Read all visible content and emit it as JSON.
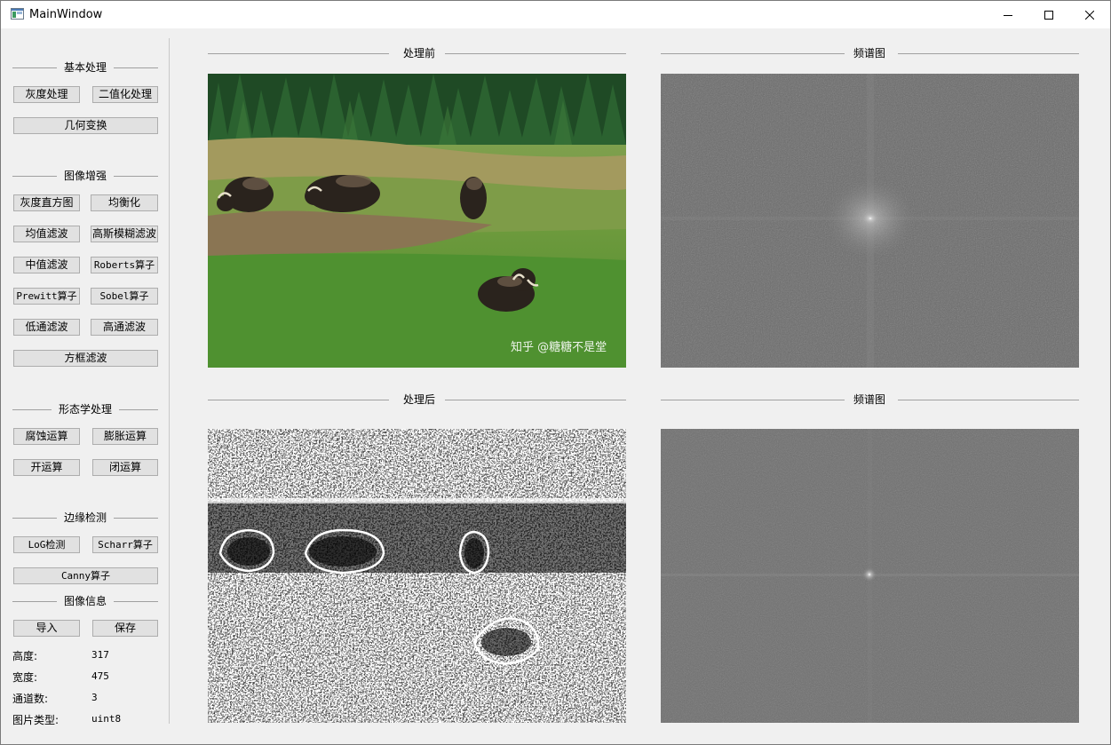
{
  "window": {
    "title": "MainWindow",
    "controls": [
      "minimize",
      "maximize",
      "close"
    ]
  },
  "sidebar": {
    "groups": {
      "basic": {
        "title": "基本处理",
        "buttons": {
          "gray": "灰度处理",
          "binary": "二值化处理",
          "geometry": "几何变换"
        }
      },
      "enhance": {
        "title": "图像增强",
        "buttons": {
          "histogram": "灰度直方图",
          "equalize": "均衡化",
          "mean_filter": "均值滤波",
          "gaussian_blur": "高斯模糊滤波",
          "median_filter": "中值滤波",
          "roberts": "Roberts算子",
          "prewitt": "Prewitt算子",
          "sobel": "Sobel算子",
          "lowpass": "低通滤波",
          "highpass": "高通滤波",
          "box_filter": "方框滤波"
        }
      },
      "morphology": {
        "title": "形态学处理",
        "buttons": {
          "erode": "腐蚀运算",
          "dilate": "膨胀运算",
          "open": "开运算",
          "close": "闭运算"
        }
      },
      "edge": {
        "title": "边缘检测",
        "buttons": {
          "log": "LoG检测",
          "scharr": "Scharr算子",
          "canny": "Canny算子"
        }
      },
      "info": {
        "title": "图像信息",
        "buttons": {
          "import": "导入",
          "save": "保存"
        },
        "fields": [
          {
            "label": "高度:",
            "value": "317"
          },
          {
            "label": "宽度:",
            "value": "475"
          },
          {
            "label": "通道数:",
            "value": "3"
          },
          {
            "label": "图片类型:",
            "value": "uint8"
          }
        ]
      }
    }
  },
  "panels": {
    "before": {
      "title": "处理前",
      "watermark": "知乎 @糖糖不是堂"
    },
    "before_spectrum": {
      "title": "频谱图"
    },
    "after": {
      "title": "处理后"
    },
    "after_spectrum": {
      "title": "频谱图"
    }
  },
  "colors": {
    "window_bg": "#f0f0f0",
    "button_bg": "#e1e1e1",
    "button_border": "#adadad",
    "spectrum_gray": "#6e6e6e"
  }
}
